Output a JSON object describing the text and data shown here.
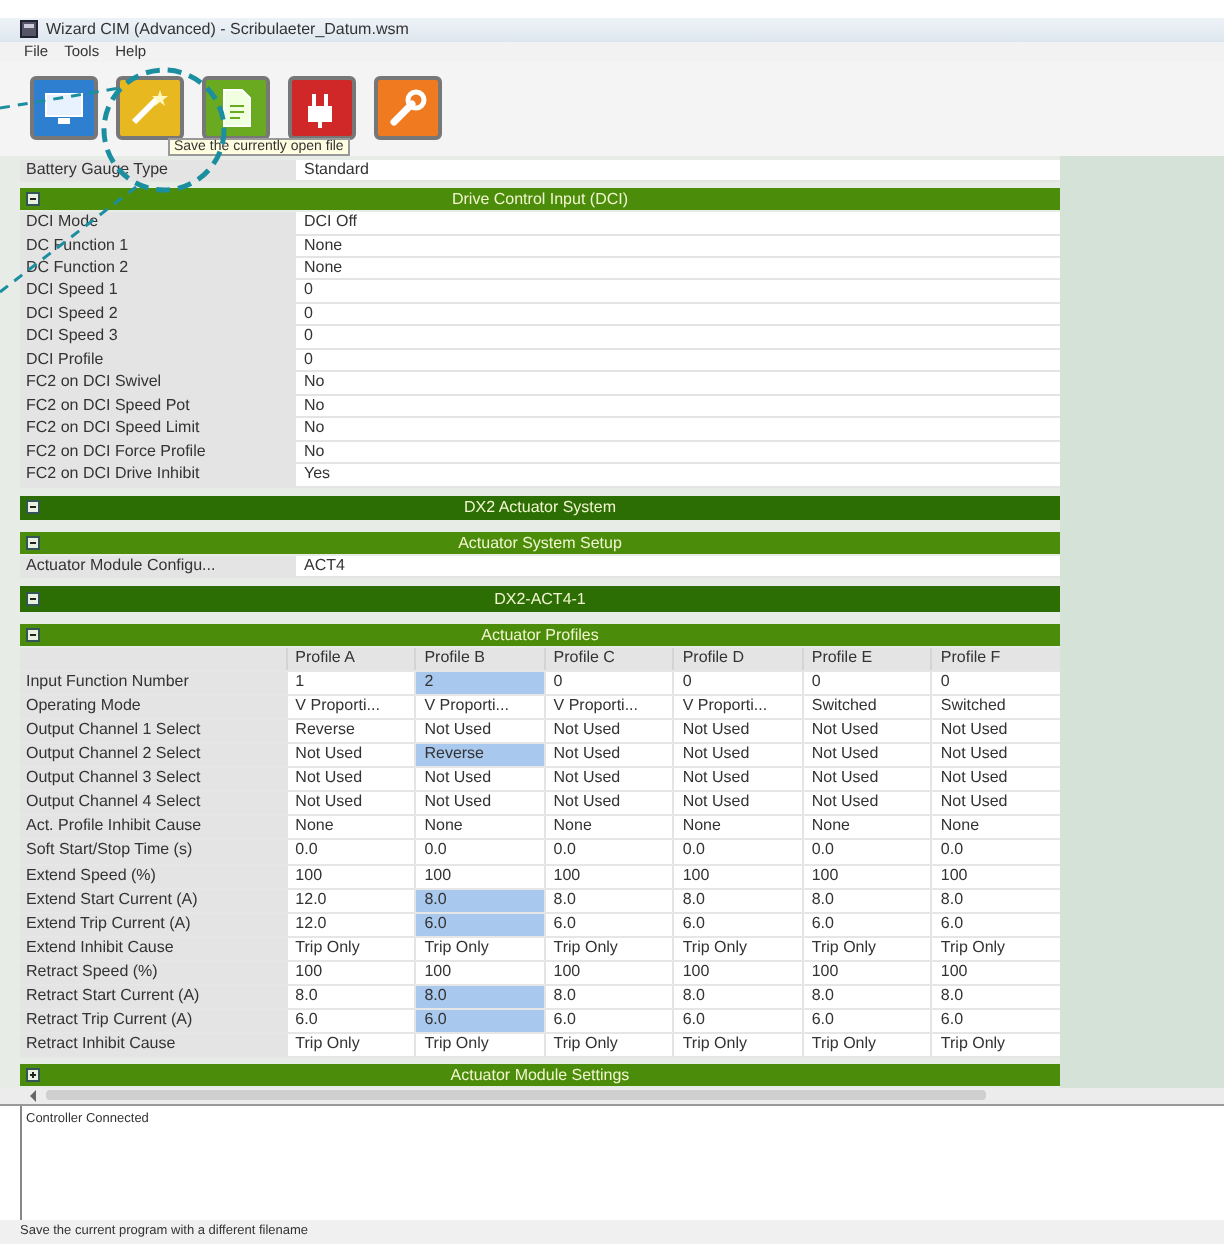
{
  "window": {
    "title": "Wizard CIM (Advanced) - Scribulaeter_Datum.wsm"
  },
  "menu": [
    "File",
    "Tools",
    "Help"
  ],
  "toolbar": [
    {
      "kind": "monitor",
      "color": "#2f7fd0"
    },
    {
      "kind": "wand",
      "color": "#e8b820"
    },
    {
      "kind": "document",
      "color": "#6aaa20"
    },
    {
      "kind": "plug",
      "color": "#d02828"
    },
    {
      "kind": "wrench",
      "color": "#f07a20"
    }
  ],
  "tooltip": "Save the currently open file",
  "sections": [
    {
      "kind": "field",
      "label": "Battery Gauge Type",
      "value": "Standard"
    },
    {
      "kind": "header",
      "title": "Drive Control Input (DCI)",
      "expanded": true
    },
    {
      "kind": "field",
      "label": "DCI Mode",
      "value": "DCI Off"
    },
    {
      "kind": "field",
      "label": "DC Function 1",
      "value": "None"
    },
    {
      "kind": "field",
      "label": "DC Function 2",
      "value": "None"
    },
    {
      "kind": "field",
      "label": "DCI Speed 1",
      "value": "0"
    },
    {
      "kind": "field",
      "label": "DCI Speed 2",
      "value": "0"
    },
    {
      "kind": "field",
      "label": "DCI Speed 3",
      "value": "0"
    },
    {
      "kind": "field",
      "label": "DCI Profile",
      "value": "0"
    },
    {
      "kind": "field",
      "label": "FC2 on DCI Swivel",
      "value": "No"
    },
    {
      "kind": "field",
      "label": "FC2 on DCI Speed Pot",
      "value": "No"
    },
    {
      "kind": "field",
      "label": "FC2 on DCI Speed Limit",
      "value": "No"
    },
    {
      "kind": "field",
      "label": "FC2 on DCI Force Profile",
      "value": "No"
    },
    {
      "kind": "field",
      "label": "FC2 on DCI Drive Inhibit",
      "value": "Yes"
    },
    {
      "kind": "group",
      "title": "DX2 Actuator System",
      "expanded": true
    },
    {
      "kind": "header",
      "title": "Actuator System Setup",
      "expanded": true
    },
    {
      "kind": "field",
      "label": "Actuator Module Configu...",
      "value": "ACT4"
    },
    {
      "kind": "group",
      "title": "DX2-ACT4-1",
      "expanded": true
    },
    {
      "kind": "header",
      "title": "Actuator Profiles",
      "expanded": true
    },
    {
      "kind": "table",
      "columns": [
        "Profile A",
        "Profile B",
        "Profile C",
        "Profile D",
        "Profile E",
        "Profile F"
      ],
      "rows": [
        {
          "label": "Input Function Number",
          "cells": [
            {
              "value": "1",
              "highlighted": false
            },
            {
              "value": "2",
              "highlighted": true
            },
            {
              "value": "0",
              "highlighted": false
            },
            {
              "value": "0",
              "highlighted": false
            },
            {
              "value": "0",
              "highlighted": false
            },
            {
              "value": "0",
              "highlighted": false
            }
          ]
        },
        {
          "label": "Operating Mode",
          "cells": [
            {
              "value": "V Proporti...",
              "highlighted": false
            },
            {
              "value": "V Proporti...",
              "highlighted": false
            },
            {
              "value": "V Proporti...",
              "highlighted": false
            },
            {
              "value": "V Proporti...",
              "highlighted": false
            },
            {
              "value": "Switched",
              "highlighted": false
            },
            {
              "value": "Switched",
              "highlighted": false
            }
          ]
        },
        {
          "label": "Output Channel 1 Select",
          "cells": [
            {
              "value": "Reverse",
              "highlighted": false
            },
            {
              "value": "Not Used",
              "highlighted": false
            },
            {
              "value": "Not Used",
              "highlighted": false
            },
            {
              "value": "Not Used",
              "highlighted": false
            },
            {
              "value": "Not Used",
              "highlighted": false
            },
            {
              "value": "Not Used",
              "highlighted": false
            }
          ]
        },
        {
          "label": "Output Channel 2 Select",
          "cells": [
            {
              "value": "Not Used",
              "highlighted": false
            },
            {
              "value": "Reverse",
              "highlighted": true
            },
            {
              "value": "Not Used",
              "highlighted": false
            },
            {
              "value": "Not Used",
              "highlighted": false
            },
            {
              "value": "Not Used",
              "highlighted": false
            },
            {
              "value": "Not Used",
              "highlighted": false
            }
          ]
        },
        {
          "label": "Output Channel 3 Select",
          "cells": [
            {
              "value": "Not Used",
              "highlighted": false
            },
            {
              "value": "Not Used",
              "highlighted": false
            },
            {
              "value": "Not Used",
              "highlighted": false
            },
            {
              "value": "Not Used",
              "highlighted": false
            },
            {
              "value": "Not Used",
              "highlighted": false
            },
            {
              "value": "Not Used",
              "highlighted": false
            }
          ]
        },
        {
          "label": "Output Channel 4 Select",
          "cells": [
            {
              "value": "Not Used",
              "highlighted": false
            },
            {
              "value": "Not Used",
              "highlighted": false
            },
            {
              "value": "Not Used",
              "highlighted": false
            },
            {
              "value": "Not Used",
              "highlighted": false
            },
            {
              "value": "Not Used",
              "highlighted": false
            },
            {
              "value": "Not Used",
              "highlighted": false
            }
          ]
        },
        {
          "label": "Act. Profile Inhibit Cause",
          "cells": [
            {
              "value": "None",
              "highlighted": false
            },
            {
              "value": "None",
              "highlighted": false
            },
            {
              "value": "None",
              "highlighted": false
            },
            {
              "value": "None",
              "highlighted": false
            },
            {
              "value": "None",
              "highlighted": false
            },
            {
              "value": "None",
              "highlighted": false
            }
          ]
        },
        {
          "label": "Soft Start/Stop Time (s)",
          "cells": [
            {
              "value": "0.0",
              "highlighted": false
            },
            {
              "value": "0.0",
              "highlighted": false
            },
            {
              "value": "0.0",
              "highlighted": false
            },
            {
              "value": "0.0",
              "highlighted": false
            },
            {
              "value": "0.0",
              "highlighted": false
            },
            {
              "value": "0.0",
              "highlighted": false
            }
          ]
        },
        {
          "label": "Extend Speed (%)",
          "cells": [
            {
              "value": "100",
              "highlighted": false
            },
            {
              "value": "100",
              "highlighted": false
            },
            {
              "value": "100",
              "highlighted": false
            },
            {
              "value": "100",
              "highlighted": false
            },
            {
              "value": "100",
              "highlighted": false
            },
            {
              "value": "100",
              "highlighted": false
            }
          ]
        },
        {
          "label": "Extend Start Current (A)",
          "cells": [
            {
              "value": "12.0",
              "highlighted": false
            },
            {
              "value": "8.0",
              "highlighted": true
            },
            {
              "value": "8.0",
              "highlighted": false
            },
            {
              "value": "8.0",
              "highlighted": false
            },
            {
              "value": "8.0",
              "highlighted": false
            },
            {
              "value": "8.0",
              "highlighted": false
            }
          ]
        },
        {
          "label": "Extend Trip Current (A)",
          "cells": [
            {
              "value": "12.0",
              "highlighted": false
            },
            {
              "value": "6.0",
              "highlighted": true
            },
            {
              "value": "6.0",
              "highlighted": false
            },
            {
              "value": "6.0",
              "highlighted": false
            },
            {
              "value": "6.0",
              "highlighted": false
            },
            {
              "value": "6.0",
              "highlighted": false
            }
          ]
        },
        {
          "label": "Extend Inhibit Cause",
          "cells": [
            {
              "value": "Trip Only",
              "highlighted": false
            },
            {
              "value": "Trip Only",
              "highlighted": false
            },
            {
              "value": "Trip Only",
              "highlighted": false
            },
            {
              "value": "Trip Only",
              "highlighted": false
            },
            {
              "value": "Trip Only",
              "highlighted": false
            },
            {
              "value": "Trip Only",
              "highlighted": false
            }
          ]
        },
        {
          "label": "Retract Speed (%)",
          "cells": [
            {
              "value": "100",
              "highlighted": false
            },
            {
              "value": "100",
              "highlighted": false
            },
            {
              "value": "100",
              "highlighted": false
            },
            {
              "value": "100",
              "highlighted": false
            },
            {
              "value": "100",
              "highlighted": false
            },
            {
              "value": "100",
              "highlighted": false
            }
          ]
        },
        {
          "label": "Retract Start Current (A)",
          "cells": [
            {
              "value": "8.0",
              "highlighted": false
            },
            {
              "value": "8.0",
              "highlighted": true
            },
            {
              "value": "8.0",
              "highlighted": false
            },
            {
              "value": "8.0",
              "highlighted": false
            },
            {
              "value": "8.0",
              "highlighted": false
            },
            {
              "value": "8.0",
              "highlighted": false
            }
          ]
        },
        {
          "label": "Retract Trip Current (A)",
          "cells": [
            {
              "value": "6.0",
              "highlighted": false
            },
            {
              "value": "6.0",
              "highlighted": true
            },
            {
              "value": "6.0",
              "highlighted": false
            },
            {
              "value": "6.0",
              "highlighted": false
            },
            {
              "value": "6.0",
              "highlighted": false
            },
            {
              "value": "6.0",
              "highlighted": false
            }
          ]
        },
        {
          "label": "Retract Inhibit Cause",
          "cells": [
            {
              "value": "Trip Only",
              "highlighted": false
            },
            {
              "value": "Trip Only",
              "highlighted": false
            },
            {
              "value": "Trip Only",
              "highlighted": false
            },
            {
              "value": "Trip Only",
              "highlighted": false
            },
            {
              "value": "Trip Only",
              "highlighted": false
            },
            {
              "value": "Trip Only",
              "highlighted": false
            }
          ]
        }
      ]
    },
    {
      "kind": "header",
      "title": "Actuator Module Settings",
      "expanded": false
    }
  ],
  "log": [
    "Controller Connected"
  ],
  "status_bar": "Save the current program with a different filename"
}
